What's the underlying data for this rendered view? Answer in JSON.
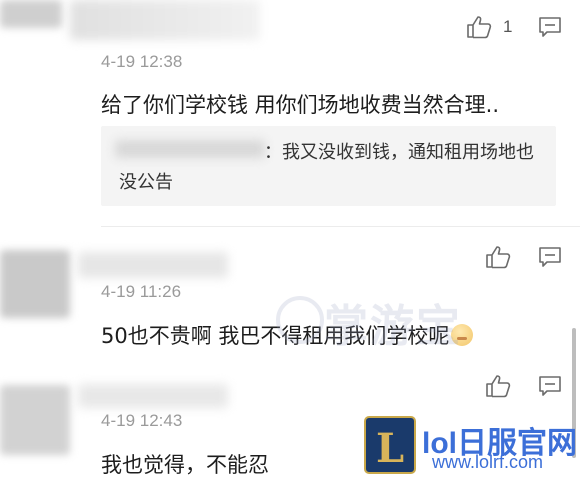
{
  "comments": [
    {
      "timestamp": "4-19 12:38",
      "text": "给了你们学校钱 用你们场地收费当然合理..",
      "like_count": "1",
      "reply": {
        "text": "：我又没收到钱，通知租用场地也没公告"
      }
    },
    {
      "timestamp": "4-19 11:26",
      "text": "50也不贵啊 我巴不得租用我们学校呢"
    },
    {
      "timestamp": "4-19 12:43",
      "text": "我也觉得，不能忍"
    }
  ],
  "icons": {
    "like": "thumbs-up-icon",
    "comment": "comment-icon",
    "emoji": "smile-emoji-icon"
  },
  "watermark": {
    "text": "掌游宝"
  },
  "brand": {
    "title": "lol日服官网",
    "url": "www.lolrf.com",
    "logo_letter": "L"
  },
  "colors": {
    "timestamp": "#9a9a9a",
    "text": "#1d1d1d",
    "reply_bg": "#f4f4f4",
    "brand_blue": "#3c6fd8"
  }
}
